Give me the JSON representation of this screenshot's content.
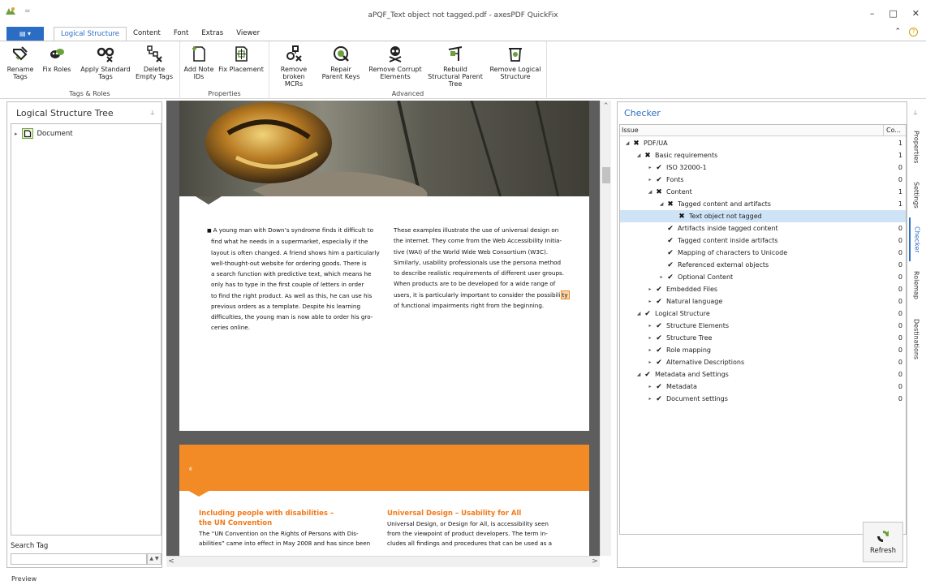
{
  "window": {
    "title": "aPQF_Text object not tagged.pdf - axesPDF QuickFix",
    "qat_separator": "=",
    "minimize": "–",
    "maximize": "□",
    "close": "✕"
  },
  "ribbon": {
    "file_tab": "▤ ▾",
    "tabs": [
      {
        "label": "Logical Structure",
        "active": true
      },
      {
        "label": "Content"
      },
      {
        "label": "Font"
      },
      {
        "label": "Extras"
      },
      {
        "label": "Viewer"
      }
    ],
    "collapse_caret": "⌃",
    "help": "?",
    "groups": [
      {
        "label": "Tags & Roles",
        "buttons": [
          {
            "label": "Rename Tags",
            "icon": "rename-tags-icon"
          },
          {
            "label": "Fix Roles",
            "icon": "fix-roles-icon"
          },
          {
            "label": "Apply Standard Tags",
            "icon": "apply-standard-tags-icon"
          },
          {
            "label": "Delete Empty Tags",
            "icon": "delete-empty-tags-icon"
          }
        ]
      },
      {
        "label": "Properties",
        "buttons": [
          {
            "label": "Add Note IDs",
            "icon": "add-note-ids-icon"
          },
          {
            "label": "Fix Placement",
            "icon": "fix-placement-icon"
          }
        ]
      },
      {
        "label": "Advanced",
        "buttons": [
          {
            "label": "Remove broken MCRs",
            "icon": "remove-broken-mcrs-icon"
          },
          {
            "label": "Repair Parent Keys",
            "icon": "repair-parent-keys-icon"
          },
          {
            "label": "Remove Corrupt Elements",
            "icon": "remove-corrupt-elements-icon"
          },
          {
            "label": "Rebuild Structural Parent Tree",
            "icon": "rebuild-parent-tree-icon"
          },
          {
            "label": "Remove Logical Structure",
            "icon": "remove-logical-structure-icon"
          }
        ]
      }
    ]
  },
  "left_panel": {
    "title": "Logical Structure Tree",
    "pin": "⊥",
    "tree_root": "Document",
    "tree_expander": "▸",
    "search_label": "Search Tag",
    "search_value": "",
    "search_stepper": "▲ ▼"
  },
  "document": {
    "page1": {
      "col1": [
        "A young man with Down’s syndrome finds it difficult to",
        "find what he needs in a supermarket, especially if the",
        "layout is often changed. A friend shows him a particularly",
        "well-thought-out website for ordering goods. There is",
        "a search function with predictive text, which means he",
        "only has to type in the first couple of letters in order",
        "to find the right product. As well as this, he can use his",
        "previous orders as a template. Despite his learning",
        "difficulties, the young man is now able to order his gro-",
        "ceries online."
      ],
      "col2": [
        "These examples illustrate the use of universal design on",
        "the internet. They come from the Web Accessibility Initia-",
        "tive (WAI) of the World Wide Web Consortium (W3C).",
        "Similarly, usability professionals use the persona method",
        "to describe realistic requirements of different user groups.",
        "When products are to be developed for a wide range of"
      ],
      "col2_line7_before": "users, it is particularly important to consider the possibili",
      "col2_line7_highlight": "ty",
      "col2_line8": "of functional impairments right from the beginning."
    },
    "page2": {
      "page_number": "6",
      "left_heading": [
        "Including people with disabilities –",
        "the UN Convention"
      ],
      "left_text": [
        "The “UN Convention on the Rights of Persons with Dis-",
        "abilities” came into effect in May 2008 and has since been"
      ],
      "right_heading": "Universal Design – Usability for All",
      "right_text": [
        "Universal Design, or Design for All, is accessibility seen",
        "from the viewpoint of product developers. The term in-",
        "cludes all findings and procedures that can be used as a"
      ]
    }
  },
  "scroll": {
    "up": "^",
    "left": "<",
    "right": ">"
  },
  "checker": {
    "title": "Checker",
    "pin": "⊥",
    "col_issue": "Issue",
    "col_count": "Co...",
    "rows": [
      {
        "label": "PDF/UA",
        "level": 0,
        "exp": "◢",
        "status": "fail",
        "count": "1"
      },
      {
        "label": "Basic requirements",
        "level": 1,
        "exp": "◢",
        "status": "fail",
        "count": "1"
      },
      {
        "label": "ISO 32000-1",
        "level": 2,
        "exp": "▸",
        "status": "pass",
        "count": "0"
      },
      {
        "label": "Fonts",
        "level": 2,
        "exp": "▸",
        "status": "pass",
        "count": "0"
      },
      {
        "label": "Content",
        "level": 2,
        "exp": "◢",
        "status": "fail",
        "count": "1"
      },
      {
        "label": "Tagged content and artifacts",
        "level": 3,
        "exp": "◢",
        "status": "fail",
        "count": "1"
      },
      {
        "label": "Text object not tagged",
        "level": 4,
        "exp": "",
        "status": "fail",
        "count": "",
        "selected": true
      },
      {
        "label": "Artifacts inside tagged content",
        "level": 3,
        "exp": "",
        "status": "pass",
        "count": "0"
      },
      {
        "label": "Tagged content inside artifacts",
        "level": 3,
        "exp": "",
        "status": "pass",
        "count": "0"
      },
      {
        "label": "Mapping of characters to Unicode",
        "level": 3,
        "exp": "",
        "status": "pass",
        "count": "0"
      },
      {
        "label": "Referenced external objects",
        "level": 3,
        "exp": "",
        "status": "pass",
        "count": "0"
      },
      {
        "label": "Optional Content",
        "level": 3,
        "exp": "▸",
        "status": "pass",
        "count": "0"
      },
      {
        "label": "Embedded Files",
        "level": 2,
        "exp": "▸",
        "status": "pass",
        "count": "0"
      },
      {
        "label": "Natural language",
        "level": 2,
        "exp": "▸",
        "status": "pass",
        "count": "0"
      },
      {
        "label": "Logical Structure",
        "level": 1,
        "exp": "◢",
        "status": "pass",
        "count": "0"
      },
      {
        "label": "Structure Elements",
        "level": 2,
        "exp": "▸",
        "status": "pass",
        "count": "0"
      },
      {
        "label": "Structure Tree",
        "level": 2,
        "exp": "▸",
        "status": "pass",
        "count": "0"
      },
      {
        "label": "Role mapping",
        "level": 2,
        "exp": "▸",
        "status": "pass",
        "count": "0"
      },
      {
        "label": "Alternative Descriptions",
        "level": 2,
        "exp": "▸",
        "status": "pass",
        "count": "0"
      },
      {
        "label": "Metadata and Settings",
        "level": 1,
        "exp": "◢",
        "status": "pass",
        "count": "0"
      },
      {
        "label": "Metadata",
        "level": 2,
        "exp": "▸",
        "status": "pass",
        "count": "0"
      },
      {
        "label": "Document settings",
        "level": 2,
        "exp": "▸",
        "status": "pass",
        "count": "0"
      }
    ],
    "refresh": "Refresh"
  },
  "side_tabs": [
    {
      "label": "Properties"
    },
    {
      "label": "Settings"
    },
    {
      "label": "Checker",
      "active": true
    },
    {
      "label": "Rolemap"
    },
    {
      "label": "Destinations"
    }
  ],
  "status": {
    "text": "Preview"
  },
  "colors": {
    "accent": "#2b6cc4",
    "orange": "#f28a26",
    "viewer_bg": "#5d5d5d",
    "selection": "#cfe3f6"
  }
}
